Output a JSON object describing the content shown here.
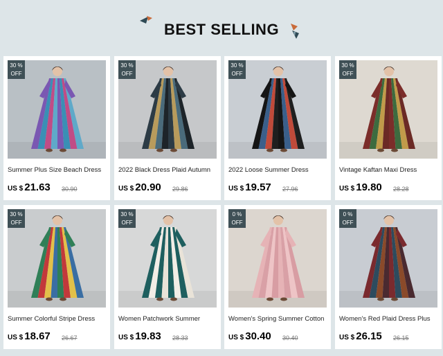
{
  "section": {
    "title": "BEST SELLING"
  },
  "products": [
    {
      "badge_pct": "30 %",
      "badge_off": "OFF",
      "name": "Summer Plus Size Beach Dress",
      "currency": "US $",
      "price": "21.63",
      "old_price": "30.90",
      "bg": "#b9c0c5",
      "dress_colors": [
        "#7a58b2",
        "#3a8fb5",
        "#c04c86",
        "#5fa9c9"
      ]
    },
    {
      "badge_pct": "30 %",
      "badge_off": "OFF",
      "name": "2022 Black Dress Plaid Autumn",
      "currency": "US $",
      "price": "20.90",
      "old_price": "29.86",
      "bg": "#c6c8ca",
      "dress_colors": [
        "#2c3b45",
        "#b89b5c",
        "#4a6b7b",
        "#1d2429"
      ]
    },
    {
      "badge_pct": "30 %",
      "badge_off": "OFF",
      "name": "2022 Loose Summer Dress",
      "currency": "US $",
      "price": "19.57",
      "old_price": "27.96",
      "bg": "#c9ced3",
      "dress_colors": [
        "#151515",
        "#3a5f8a",
        "#c04a3a",
        "#1f1f1f"
      ]
    },
    {
      "badge_pct": "30 %",
      "badge_off": "OFF",
      "name": "Vintage Kaftan Maxi Dress",
      "currency": "US $",
      "price": "19.80",
      "old_price": "28.28",
      "bg": "#ded9d1",
      "dress_colors": [
        "#7b2d2a",
        "#3d6b3f",
        "#c19b4a",
        "#6b2a25"
      ]
    },
    {
      "badge_pct": "30 %",
      "badge_off": "OFF",
      "name": "Summer Colorful Stripe Dress",
      "currency": "US $",
      "price": "18.67",
      "old_price": "26.67",
      "bg": "#c9ccce",
      "dress_colors": [
        "#2f7f57",
        "#c2393b",
        "#e2c04a",
        "#3a6ea3"
      ]
    },
    {
      "badge_pct": "30 %",
      "badge_off": "OFF",
      "name": "Women Patchwork Summer",
      "currency": "US $",
      "price": "19.83",
      "old_price": "28.33",
      "bg": "#d7d8d8",
      "dress_colors": [
        "#1e5f5f",
        "#f2ede6",
        "#1e5f5f",
        "#e9e3d8"
      ]
    },
    {
      "badge_pct": "0 %",
      "badge_off": "OFF",
      "name": "Women's Spring Summer Cotton",
      "currency": "US $",
      "price": "30.40",
      "old_price": "30.40",
      "bg": "#dcd6cf",
      "dress_colors": [
        "#e6b3b6",
        "#d9a0a6",
        "#eec4c6",
        "#d89da3"
      ]
    },
    {
      "badge_pct": "0 %",
      "badge_off": "OFF",
      "name": "Women's Red Plaid Dress Plus",
      "currency": "US $",
      "price": "26.15",
      "old_price": "26.15",
      "bg": "#c8ccd2",
      "dress_colors": [
        "#7a2a2e",
        "#2d4b5e",
        "#8a4a2a",
        "#4a2a30"
      ]
    }
  ]
}
